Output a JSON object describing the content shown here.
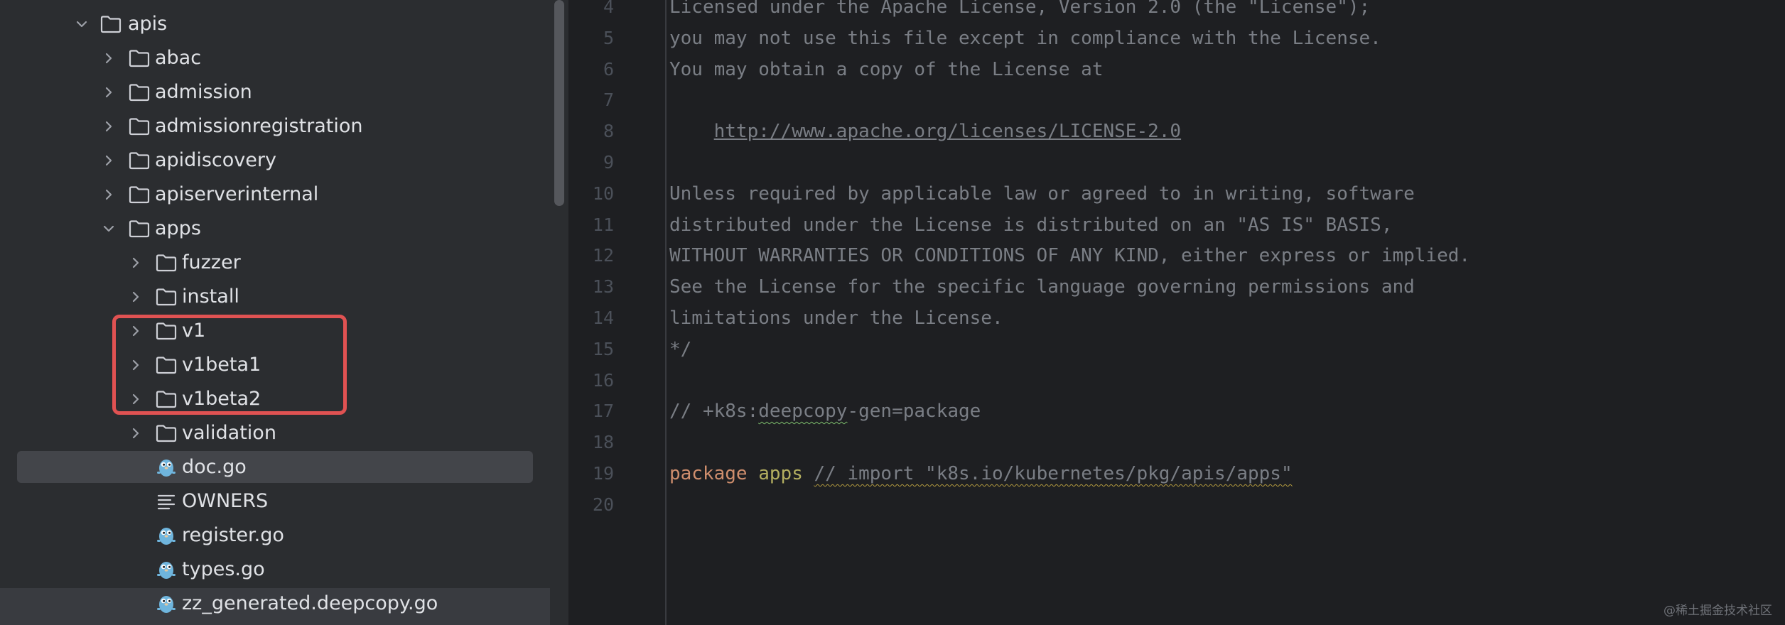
{
  "project_tree": {
    "items": [
      {
        "label": "apis",
        "type": "folder",
        "expanded": true
      },
      {
        "label": "abac",
        "type": "folder",
        "expanded": false
      },
      {
        "label": "admission",
        "type": "folder",
        "expanded": false
      },
      {
        "label": "admissionregistration",
        "type": "folder",
        "expanded": false
      },
      {
        "label": "apidiscovery",
        "type": "folder",
        "expanded": false
      },
      {
        "label": "apiserverinternal",
        "type": "folder",
        "expanded": false
      },
      {
        "label": "apps",
        "type": "folder",
        "expanded": true
      },
      {
        "label": "fuzzer",
        "type": "folder",
        "expanded": false
      },
      {
        "label": "install",
        "type": "folder",
        "expanded": false
      },
      {
        "label": "v1",
        "type": "folder",
        "expanded": false
      },
      {
        "label": "v1beta1",
        "type": "folder",
        "expanded": false
      },
      {
        "label": "v1beta2",
        "type": "folder",
        "expanded": false
      },
      {
        "label": "validation",
        "type": "folder",
        "expanded": false
      },
      {
        "label": "doc.go",
        "type": "go-file",
        "selected": true
      },
      {
        "label": "OWNERS",
        "type": "text-file"
      },
      {
        "label": "register.go",
        "type": "go-file"
      },
      {
        "label": "types.go",
        "type": "go-file"
      },
      {
        "label": "zz_generated.deepcopy.go",
        "type": "go-file"
      }
    ]
  },
  "editor": {
    "lines": [
      {
        "num": "4",
        "text": "Licensed under the Apache License, Version 2.0 (the \"License\");"
      },
      {
        "num": "5",
        "text": "you may not use this file except in compliance with the License."
      },
      {
        "num": "6",
        "text": "You may obtain a copy of the License at"
      },
      {
        "num": "7",
        "text": ""
      },
      {
        "num": "8",
        "text": "    ",
        "link": "http://www.apache.org/licenses/LICENSE-2.0"
      },
      {
        "num": "9",
        "text": ""
      },
      {
        "num": "10",
        "text": "Unless required by applicable law or agreed to in writing, software"
      },
      {
        "num": "11",
        "text": "distributed under the License is distributed on an \"AS IS\" BASIS,"
      },
      {
        "num": "12",
        "text": "WITHOUT WARRANTIES OR CONDITIONS OF ANY KIND, either express or implied."
      },
      {
        "num": "13",
        "text": "See the License for the specific language governing permissions and"
      },
      {
        "num": "14",
        "text": "limitations under the License."
      },
      {
        "num": "15",
        "text": "*/"
      },
      {
        "num": "16",
        "text": ""
      },
      {
        "num": "17",
        "prefix": "// +k8s:",
        "squiggle": "deepcopy",
        "suffix": "-gen=package"
      },
      {
        "num": "18",
        "text": ""
      },
      {
        "num": "19",
        "keyword": "package",
        "pkg": "apps",
        "comment": "// import \"k8s.io/kubernetes/pkg/apis/apps\""
      },
      {
        "num": "20",
        "text": ""
      }
    ]
  },
  "watermark": "@稀土掘金技术社区",
  "colors": {
    "tree_bg": "#2b2d30",
    "editor_bg": "#1e1f22",
    "highlight_border": "#e05252",
    "keyword": "#cf8e6d",
    "package_name": "#b3ae60",
    "comment": "#7a7e85"
  }
}
